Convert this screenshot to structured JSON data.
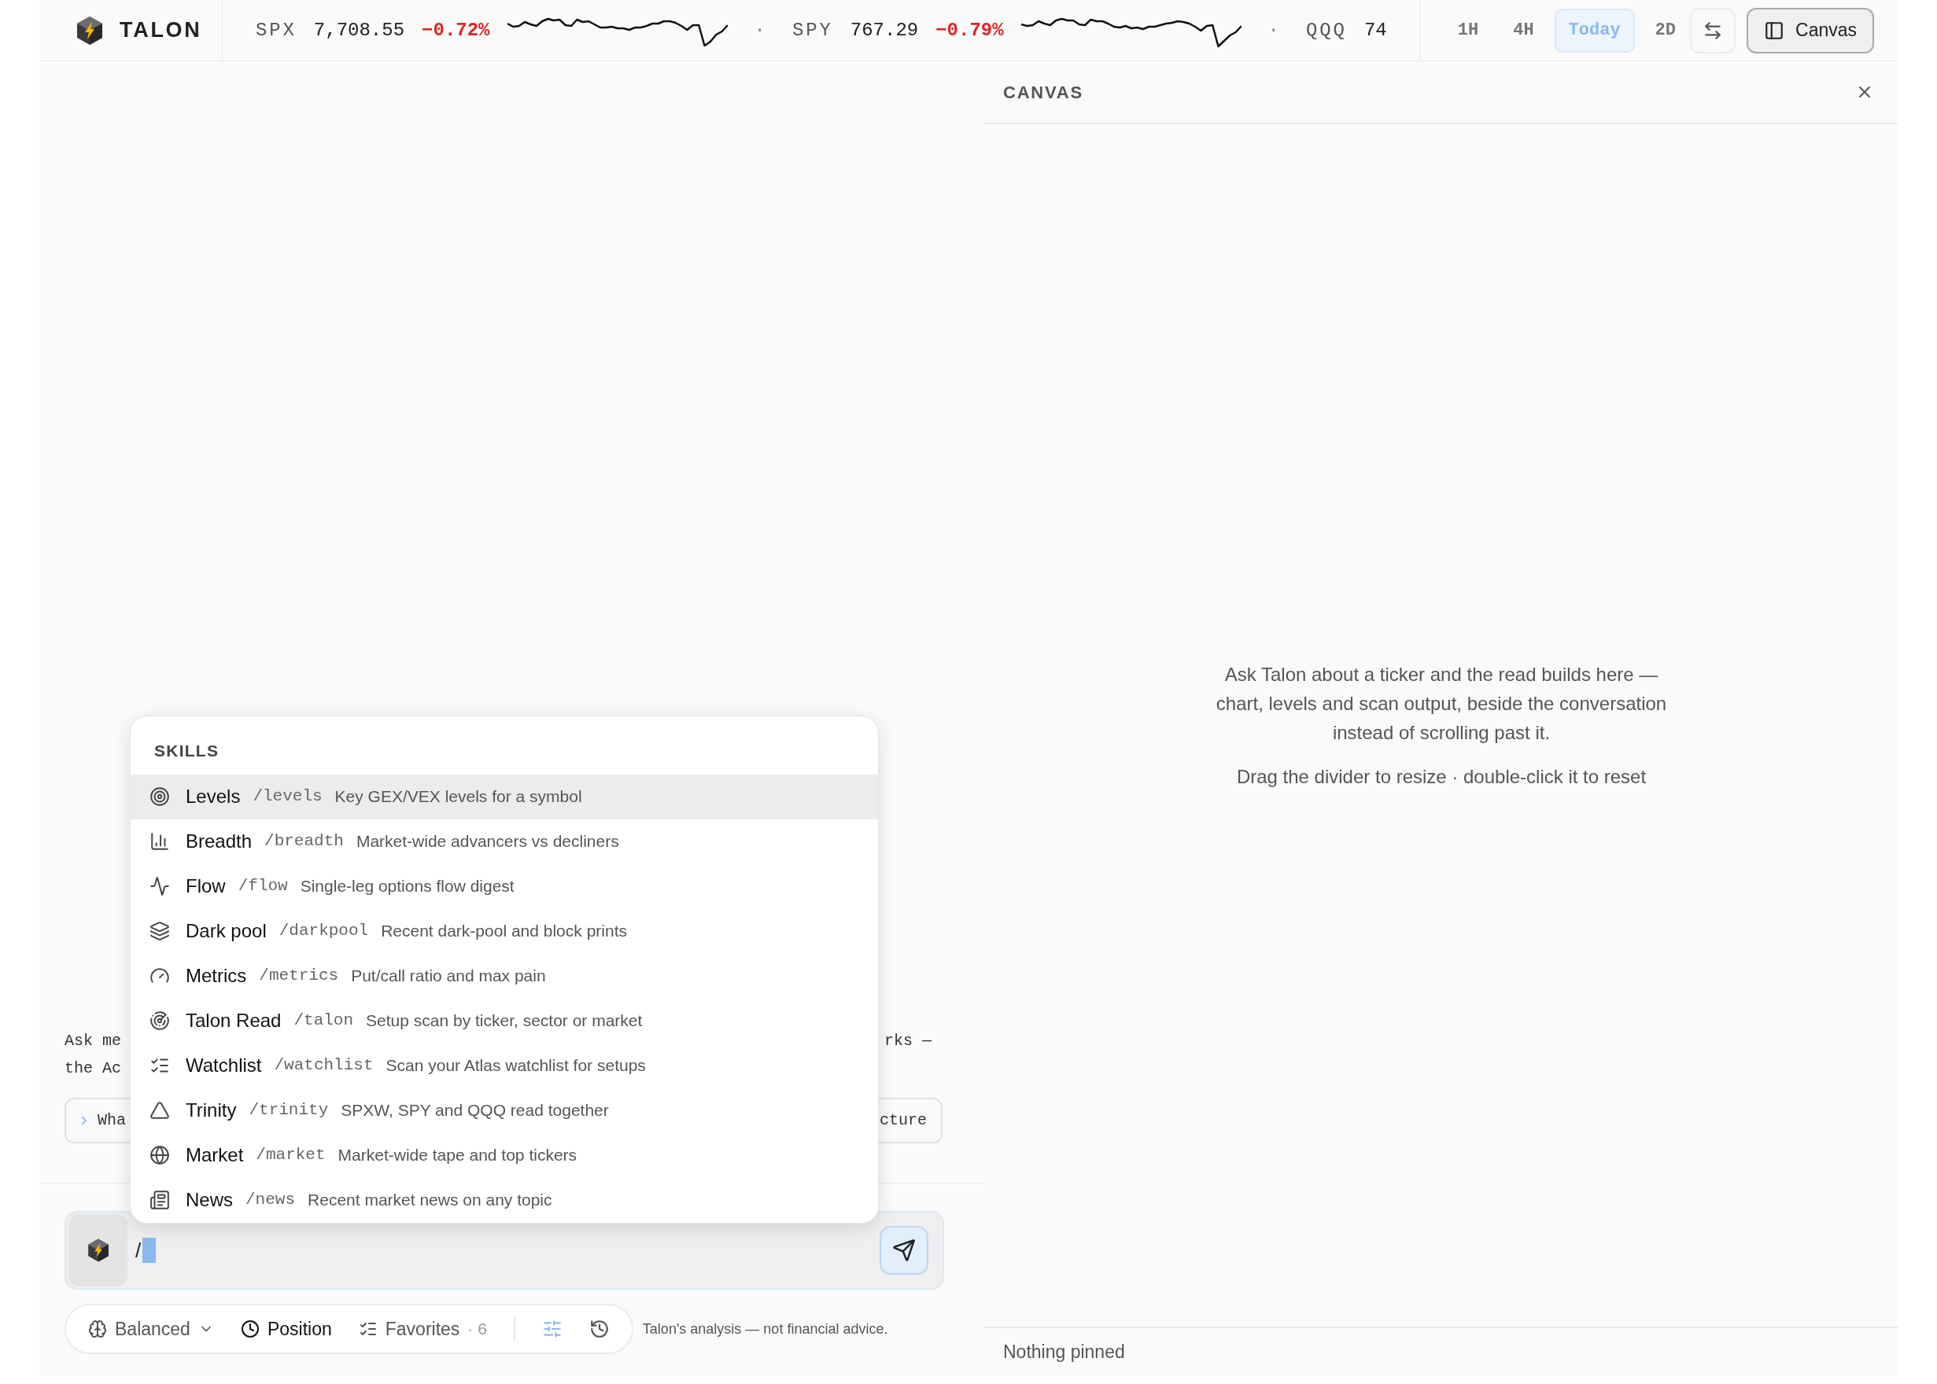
{
  "app": {
    "name": "TALON"
  },
  "tickers": [
    {
      "symbol": "SPX",
      "price": "7,708.55",
      "change": "−0.72%"
    },
    {
      "prefix": "·",
      "symbol": "SPY",
      "price": "767.29",
      "change": "−0.79%"
    },
    {
      "prefix": "·",
      "symbol": "QQQ",
      "price": "74"
    }
  ],
  "ranges": [
    {
      "label": "1H",
      "selected": false
    },
    {
      "label": "4H",
      "selected": false
    },
    {
      "label": "Today",
      "selected": true
    },
    {
      "label": "2D",
      "selected": false
    }
  ],
  "canvas_toggle": {
    "label": "Canvas",
    "on": true
  },
  "conversation": {
    "intro": [
      {
        "left": "Ask me",
        "right": "rks —"
      },
      {
        "left": "the Ac"
      }
    ],
    "chips": [
      {
        "text": "Wha",
        "arrow": true
      },
      {
        "text": "cture",
        "arrow": false
      }
    ]
  },
  "skills_menu": {
    "title": "SKILLS",
    "items": [
      {
        "name": "Levels",
        "command": "/levels",
        "description": "Key GEX/VEX levels for a symbol",
        "selected": true
      },
      {
        "name": "Breadth",
        "command": "/breadth",
        "description": "Market-wide advancers vs decliners",
        "selected": false
      },
      {
        "name": "Flow",
        "command": "/flow",
        "description": "Single-leg options flow digest",
        "selected": false
      },
      {
        "name": "Dark pool",
        "command": "/darkpool",
        "description": "Recent dark-pool and block prints",
        "selected": false
      },
      {
        "name": "Metrics",
        "command": "/metrics",
        "description": "Put/call ratio and max pain",
        "selected": false
      },
      {
        "name": "Talon Read",
        "command": "/talon",
        "description": "Setup scan by ticker, sector or market",
        "selected": false
      },
      {
        "name": "Watchlist",
        "command": "/watchlist",
        "description": "Scan your Atlas watchlist for setups",
        "selected": false
      },
      {
        "name": "Trinity",
        "command": "/trinity",
        "description": "SPXW, SPY and QQQ read together",
        "selected": false
      },
      {
        "name": "Market",
        "command": "/market",
        "description": "Market-wide tape and top tickers",
        "selected": false
      },
      {
        "name": "News",
        "command": "/news",
        "description": "Recent market news on any topic",
        "selected": false
      }
    ]
  },
  "composer": {
    "value": "/"
  },
  "toolbar": {
    "mode": "Balanced",
    "position": {
      "label": "Position",
      "on": true
    },
    "favorites": {
      "label": "Favorites",
      "count": "· 6",
      "on": false
    },
    "filters": {
      "on": true
    },
    "history": {
      "on": false
    }
  },
  "disclaimer": "Talon's analysis — not financial advice.",
  "canvas": {
    "title": "CANVAS",
    "message": "Ask Talon about a ticker and the read builds here — chart, levels and scan output, beside the conversation instead of scrolling past it.",
    "hint": "Drag the divider to resize · double-click it to reset",
    "footer": "Nothing pinned"
  }
}
